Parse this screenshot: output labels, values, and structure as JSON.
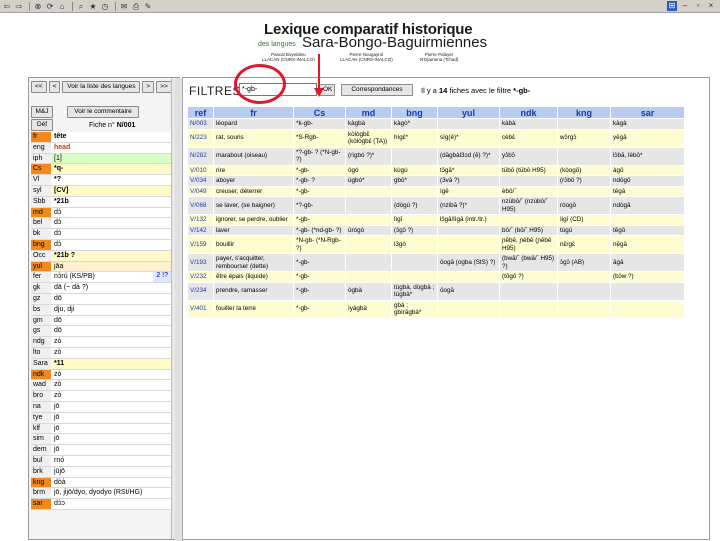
{
  "toolbar": {
    "icons": [
      "back-icon",
      "forward-icon",
      "stop-icon",
      "refresh-icon",
      "home-icon",
      "search-icon",
      "favorites-icon",
      "history-icon",
      "mail-icon",
      "print-icon",
      "edit-icon"
    ]
  },
  "header": {
    "title1": "Lexique comparatif historique",
    "title_prefix": "des langues",
    "title2": "Sara-Bongo-Baguirmiennes",
    "authors": [
      {
        "name": "Pascal Boyeldieu",
        "affil": "LLACAN (CNRS-INALCO)"
      },
      {
        "name": "Pierre Nougayrol",
        "affil": "LLACAN (CNRS-INALCO)"
      },
      {
        "name": "Pierre Palayer",
        "affil": "N'Djamena (Tchad)"
      }
    ]
  },
  "leftnav": {
    "first": "<<",
    "prev": "<",
    "list": "Voir la liste des langues",
    "next": ">",
    "last": ">>"
  },
  "left": {
    "maj": "M&J",
    "comment": "Voir le commentaire",
    "def": "Déf",
    "fiche_label": "Fiche n°",
    "fiche_num": "N/001",
    "rows": [
      {
        "code": "fr",
        "val": "tête",
        "cls": "or bold"
      },
      {
        "code": "eng",
        "val": "head",
        "cls": "head"
      },
      {
        "code": "iph",
        "val": "[1]",
        "cls": "gr"
      },
      {
        "code": "Cs",
        "val": "*q-",
        "cls": "or bold ye"
      },
      {
        "code": "Vl",
        "val": "*?",
        "cls": "bold"
      },
      {
        "code": "syl",
        "val": "[CV]",
        "cls": "bold ye"
      },
      {
        "code": "Sbb",
        "val": "*21b",
        "cls": "bold"
      },
      {
        "code": "md",
        "val": "dɔ̀",
        "cls": "or"
      },
      {
        "code": "bel",
        "val": "dɔ̀",
        "cls": ""
      },
      {
        "code": "bk",
        "val": "dɔ̀",
        "cls": ""
      },
      {
        "code": "bng",
        "val": "dɔ̀",
        "cls": "or"
      },
      {
        "code": "Occ",
        "val": "*21b ?",
        "cls": "bold ye"
      },
      {
        "code": "yul",
        "val": "jāa",
        "cls": "or or2"
      },
      {
        "code": "fer",
        "val": "nɔ̀rú (KS/PB)",
        "cls": "",
        "note": "2 !?"
      },
      {
        "code": "gk",
        "val": "dā (~ dà ?)",
        "cls": ""
      },
      {
        "code": "gz",
        "val": "dō",
        "cls": ""
      },
      {
        "code": "bs",
        "val": "dju, dji",
        "cls": ""
      },
      {
        "code": "gm",
        "val": "dō",
        "cls": ""
      },
      {
        "code": "gs",
        "val": "dō",
        "cls": ""
      },
      {
        "code": "ndg",
        "val": "zò",
        "cls": ""
      },
      {
        "code": "lto",
        "val": "zò",
        "cls": ""
      },
      {
        "code": "Sara",
        "val": "*11",
        "cls": "bold ye"
      },
      {
        "code": "ndk",
        "val": "zò",
        "cls": "or"
      },
      {
        "code": "wad",
        "val": "zò",
        "cls": ""
      },
      {
        "code": "bro",
        "val": "zò",
        "cls": ""
      },
      {
        "code": "na",
        "val": "jō",
        "cls": ""
      },
      {
        "code": "tye",
        "val": "jō",
        "cls": ""
      },
      {
        "code": "klf",
        "val": "jō",
        "cls": ""
      },
      {
        "code": "sim",
        "val": "jō",
        "cls": ""
      },
      {
        "code": "dem",
        "val": "jō",
        "cls": ""
      },
      {
        "code": "bul",
        "val": "rnó",
        "cls": ""
      },
      {
        "code": "brk",
        "val": "jūjō",
        "cls": ""
      },
      {
        "code": "kng",
        "val": "dòà",
        "cls": "or"
      },
      {
        "code": "brm",
        "val": "jō, jijō/dyo, dyodyo (RSt/HG)",
        "cls": ""
      },
      {
        "code": "sar",
        "val": "dɔ̀ɔ",
        "cls": "or"
      }
    ]
  },
  "filter": {
    "label": "FILTRES",
    "value": "*-gb-",
    "ok": "OK",
    "corr": "Correspondances",
    "count_pre": "Il y a",
    "count_num": "14",
    "count_post": "fiches avec le filtre",
    "count_filter": "*-gb-"
  },
  "table": {
    "headers": [
      "ref",
      "fr",
      "Cs",
      "md",
      "bng",
      "yul",
      "ndk",
      "kng",
      "sar"
    ],
    "rows": [
      {
        "cls": "g",
        "cells": [
          "N/003",
          "léopard",
          "*k-gb-",
          "kàgbà",
          "kàgò*",
          "",
          "kàbà",
          "",
          "kàgà"
        ]
      },
      {
        "cls": "y",
        "cells": [
          "N/223",
          "rat, souris",
          "*S-Rgb-",
          "kòlògbɛ̀ (kòlògbɛ̀ (TA))",
          "hìgɛ̀*",
          "sīg(ē)*",
          "cèbɛ̀",
          "wɔ̀rgɔ̀",
          "yēgā"
        ]
      },
      {
        "cls": "g",
        "cells": [
          "N/282",
          "marabout (oiseau)",
          "*?-gb- ? (*N-gb- ?)",
          "(rìgbó ?)*",
          "",
          "(dāgbàl3ɔd (ē) ?)*",
          "yɔ̀bɔ̀",
          "",
          "lɔ̀bā, lèbō*"
        ]
      },
      {
        "cls": "y",
        "cells": [
          "V/010",
          "rire",
          "*-gb-",
          "ògó",
          "kùgú",
          "tɔ̄gā*",
          "tūbō (tūbō H95)",
          "(kòogō)",
          "àgō"
        ]
      },
      {
        "cls": "g",
        "cells": [
          "V/034",
          "aboyer",
          "*-gb- ?",
          "úgbó*",
          "gbō*",
          "(3vā ?)",
          "",
          "(rɔ̀bō ?)",
          "ndōgō"
        ]
      },
      {
        "cls": "y",
        "cells": [
          "V/049",
          "creuser, déterrer",
          "*-gb-",
          "",
          "",
          "ìgē",
          "èbō/ˉ",
          "",
          "tēgā"
        ]
      },
      {
        "cls": "g",
        "cells": [
          "V/068",
          "se laver, (se baigner)",
          "*?-gb-",
          "",
          "(dògú ?)",
          "(nzibā ?)*",
          "nzūbō/ˉ (nzùbō/ˉ H95)",
          "ròogō",
          "ndògā"
        ]
      },
      {
        "cls": "y",
        "cells": [
          "V/132",
          "ignorer, se perdre, oublier",
          "*-gb-",
          "",
          "lìgī",
          "lɔ̄gā/lìgā (intr./tr.)",
          "",
          "ìigī (CD)",
          ""
        ]
      },
      {
        "cls": "g",
        "cells": [
          "V/142",
          "laver",
          "*-gb- (*nd-gb- ?)",
          "ùrògò",
          "(ɔ̄gɔ̄ ?)",
          "",
          "bō/ˉ (bō/ˉ H95)",
          "tùgù",
          "tēgō"
        ]
      },
      {
        "cls": "y",
        "cells": [
          "V/159",
          "bouillir",
          "*N-gb- (*N-Rgb- ?)",
          "",
          "l3gò",
          "",
          "ɲēbē, ɲēbē (ɲēbē H95)",
          "nɛ̄rgɛ̄",
          "nēgā"
        ]
      },
      {
        "cls": "g",
        "cells": [
          "V/193",
          "payer, s'acquitter, rembourser (dette)",
          "*-gb-",
          "",
          "",
          "ōogā (ogba (StS) ?)",
          "(bwā/ˉ (bwā/ˉ H95) ?)",
          "ɔ̀gɔ̀ (AB)",
          "āgā"
        ]
      },
      {
        "cls": "y",
        "cells": [
          "V/232",
          "être épais (liquide)",
          "*-gb-",
          "",
          "",
          "",
          "(tōgō ?)",
          "",
          "(bɔ̀w ?)"
        ]
      },
      {
        "cls": "g",
        "cells": [
          "V/234",
          "prendre, ramasser",
          "*-gb-",
          "ògbà",
          "tùgbà, dùgbà ; tùgbà*",
          "ōogā",
          "",
          "",
          ""
        ]
      },
      {
        "cls": "y",
        "cells": [
          "V/401",
          "fouiller la terre",
          "*-gb-",
          "ìyàgbà",
          "gbà ; gbìrāgbà*",
          "",
          "",
          "",
          ""
        ]
      }
    ]
  },
  "colors": {
    "accent_red": "#e0182c",
    "header_blue": "#b9ccef",
    "orange": "#f08a1c",
    "row_yellow": "#fffcd2",
    "row_gray": "#e6e6e6"
  }
}
